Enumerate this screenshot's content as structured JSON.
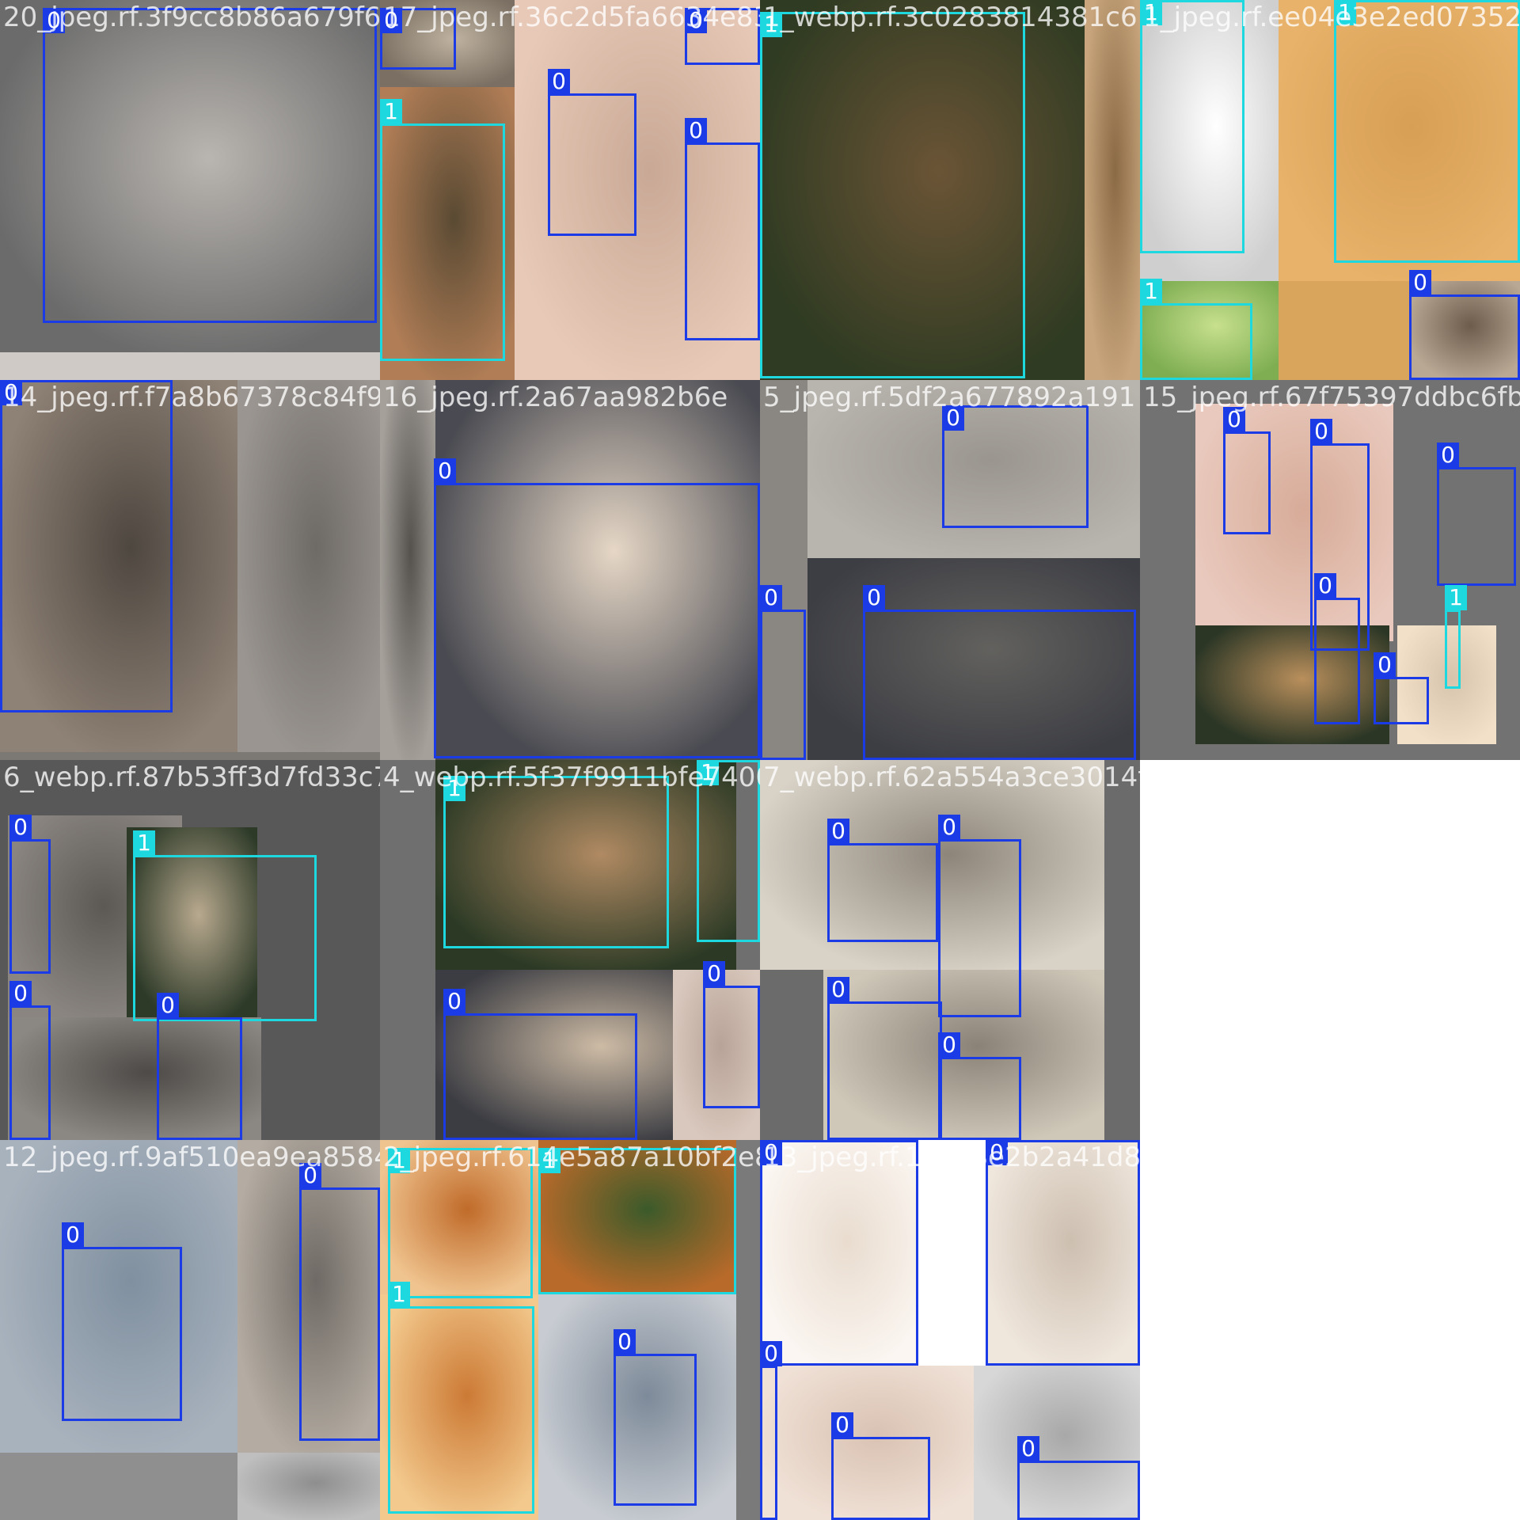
{
  "colors": {
    "class_0": "#1a3be6",
    "class_1": "#1ed8e0",
    "pad": "#727272"
  },
  "tiles": [
    {
      "file": "20_jpeg.rf.3f9cc8b86a679f6",
      "bg": "#cfcac5",
      "pieces": [
        {
          "c": [
            "#6b6b6b",
            "#b9b5b0"
          ]
        }
      ],
      "boxes": [
        {
          "cls": "0"
        },
        {
          "cls": "0"
        }
      ]
    },
    {
      "file": "17_jpeg.rf.36c2d5fa6634e83c",
      "bg": "#d9c2b3",
      "pieces": [
        {
          "c": [
            "#7a6f62",
            "#bfb2a0"
          ]
        },
        {
          "c": [
            "#b07d56",
            "#5a4a33"
          ]
        },
        {
          "c": [
            "#e8c9b7",
            "#c9a996"
          ]
        }
      ],
      "boxes": [
        {
          "cls": "0"
        },
        {
          "cls": "1"
        },
        {
          "cls": "0"
        },
        {
          "cls": "0"
        },
        {
          "cls": "0"
        }
      ]
    },
    {
      "file": "1_webp.rf.3c0283814381c6",
      "bg": "#3c4a2e",
      "pieces": [
        {
          "c": [
            "#2f3b22",
            "#6b5436"
          ]
        },
        {
          "c": [
            "#c8a57c",
            "#8a6a45"
          ]
        }
      ],
      "boxes": [
        {
          "cls": "1"
        },
        {
          "cls": "0"
        }
      ]
    },
    {
      "file": "1_jpeg.rf.ee04e3e2ed07352fca",
      "bg": "#d9a55d",
      "pieces": [
        {
          "c": [
            "#cfcfcf",
            "#ffffff"
          ]
        },
        {
          "c": [
            "#e8b26a",
            "#d79f55"
          ]
        },
        {
          "c": [
            "#7fae52",
            "#c7e08e"
          ]
        },
        {
          "c": [
            "#b9a894",
            "#6d5c4c"
          ]
        }
      ],
      "boxes": [
        {
          "cls": "1"
        },
        {
          "cls": "1"
        },
        {
          "cls": "1"
        },
        {
          "cls": "0"
        }
      ]
    },
    {
      "file": "14_jpeg.rf.f7a8b67378c84f94",
      "bg": "#7c7874",
      "pieces": [
        {
          "c": [
            "#8e8175",
            "#4e4740"
          ]
        },
        {
          "c": [
            "#9a9590",
            "#6e6a66"
          ]
        }
      ],
      "boxes": [
        {
          "cls": "0"
        }
      ]
    },
    {
      "file": "16_jpeg.rf.2a67aa982b6e",
      "bg": "#3b3c40",
      "pieces": [
        {
          "c": [
            "#a5a09a",
            "#55524e"
          ]
        },
        {
          "c": [
            "#4a4b52",
            "#e6d7c6"
          ]
        }
      ],
      "boxes": [
        {
          "cls": "0"
        }
      ]
    },
    {
      "file": "5_jpeg.rf.5df2a677892a191",
      "bg": "#8a8782",
      "pieces": [
        {
          "c": [
            "#b8b4ae",
            "#9a958f"
          ]
        },
        {
          "c": [
            "#3d3e44",
            "#62615e"
          ]
        }
      ],
      "boxes": [
        {
          "cls": "0"
        },
        {
          "cls": "0"
        },
        {
          "cls": "0"
        }
      ]
    },
    {
      "file": "15_jpeg.rf.67f75397ddbc6fb6",
      "bg": "#727272",
      "pieces": [
        {
          "c": [
            "#e9c9bd",
            "#d7ab98"
          ]
        },
        {
          "c": [
            "#2b3625",
            "#b98f5c"
          ]
        },
        {
          "c": [
            "#f2e0c8",
            "#d7c4ad"
          ]
        }
      ],
      "boxes": [
        {
          "cls": "0"
        },
        {
          "cls": "0"
        },
        {
          "cls": "0"
        },
        {
          "cls": "0"
        },
        {
          "cls": "1"
        },
        {
          "cls": "0"
        }
      ]
    },
    {
      "file": "6_webp.rf.87b53ff3d7fd33c74",
      "bg": "#585858",
      "pieces": [
        {
          "c": [
            "#8a8580",
            "#5c5955"
          ]
        },
        {
          "c": [
            "#2d3a28",
            "#b8a98f"
          ]
        },
        {
          "c": [
            "#8b8782",
            "#4d4a47"
          ]
        }
      ],
      "boxes": [
        {
          "cls": "0"
        },
        {
          "cls": "1"
        },
        {
          "cls": "0"
        },
        {
          "cls": "0"
        }
      ]
    },
    {
      "file": "4_webp.rf.5f37f9911bfe74007",
      "bg": "#6f6f6f",
      "pieces": [
        {
          "c": [
            "#2c3a25",
            "#b08a63"
          ]
        },
        {
          "c": [
            "#3c3d43",
            "#cdbba5"
          ]
        },
        {
          "c": [
            "#d9c8bd",
            "#b8a398"
          ]
        }
      ],
      "boxes": [
        {
          "cls": "1"
        },
        {
          "cls": "1"
        },
        {
          "cls": "0"
        },
        {
          "cls": "0"
        }
      ]
    },
    {
      "file": "7_webp.rf.62a554a3ce3014ffc2075260c25128",
      "bg": "#6b6b6b",
      "pieces": [
        {
          "c": [
            "#d8d2c7",
            "#8d857a"
          ]
        },
        {
          "c": [
            "#cfc7b8",
            "#8a8277"
          ]
        }
      ],
      "boxes": [
        {
          "cls": "0"
        },
        {
          "cls": "0"
        },
        {
          "cls": "0"
        },
        {
          "cls": "0"
        }
      ]
    },
    {
      "file": "",
      "bg": "#ffffff",
      "pieces": [],
      "boxes": []
    },
    {
      "file": "12_jpeg.rf.9af510ea9ea85848",
      "bg": "#8f8f8f",
      "pieces": [
        {
          "c": [
            "#a8b2bd",
            "#8090a0"
          ]
        },
        {
          "c": [
            "#b4aca2",
            "#6f6a65"
          ]
        },
        {
          "c": [
            "#bfbfbf",
            "#8e8e8e"
          ]
        }
      ],
      "boxes": [
        {
          "cls": "0"
        },
        {
          "cls": "0"
        }
      ]
    },
    {
      "file": "2_jpeg.rf.614e5a87a10bf2e86",
      "bg": "#7a7a7a",
      "pieces": [
        {
          "c": [
            "#f0c48f",
            "#c06b2a"
          ]
        },
        {
          "c": [
            "#b86a2a",
            "#3b5a2a"
          ]
        },
        {
          "c": [
            "#f3c98d",
            "#cc7a35"
          ]
        },
        {
          "c": [
            "#c8ccd2",
            "#7d8a99"
          ]
        }
      ],
      "boxes": [
        {
          "cls": "1"
        },
        {
          "cls": "1"
        },
        {
          "cls": "1"
        },
        {
          "cls": "0"
        }
      ]
    },
    {
      "file": "13_jpeg.rf.1c5d8e2b2a41d8f03b85aa5b99c",
      "bg": "#ffffff",
      "pieces": [
        {
          "c": [
            "#fbf6f1",
            "#e9dccf"
          ]
        },
        {
          "c": [
            "#efe6dc",
            "#cdbfb0"
          ]
        },
        {
          "c": [
            "#f0e1d6",
            "#d9c2b3"
          ]
        },
        {
          "c": [
            "#d7d7d7",
            "#a8a8a8"
          ]
        }
      ],
      "boxes": [
        {
          "cls": "0"
        },
        {
          "cls": "0"
        },
        {
          "cls": "0"
        },
        {
          "cls": "0"
        },
        {
          "cls": "0"
        }
      ]
    },
    {
      "file": "",
      "bg": "#ffffff",
      "pieces": [],
      "boxes": []
    }
  ]
}
